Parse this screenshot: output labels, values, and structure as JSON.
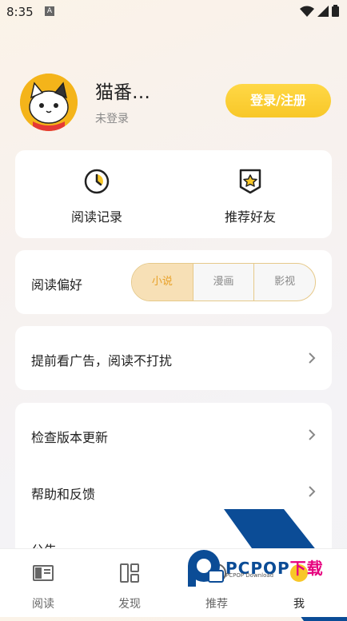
{
  "status_bar": {
    "time": "8:35",
    "notif_icon": "A"
  },
  "profile": {
    "username": "猫番…",
    "login_status": "未登录",
    "login_button": "登录/注册"
  },
  "quick_actions": [
    {
      "label": "阅读记录",
      "icon": "clock-icon"
    },
    {
      "label": "推荐好友",
      "icon": "star-badge-icon"
    }
  ],
  "reading_preference": {
    "label": "阅读偏好",
    "options": [
      "小说",
      "漫画",
      "影视"
    ],
    "selected": "小说"
  },
  "ad_row": {
    "label": "提前看广告，阅读不打扰"
  },
  "settings": [
    {
      "label": "检查版本更新"
    },
    {
      "label": "帮助和反馈"
    },
    {
      "label": "公告"
    }
  ],
  "tabs": [
    {
      "label": "阅读",
      "icon": "book-icon"
    },
    {
      "label": "发现",
      "icon": "grid-icon"
    },
    {
      "label": "推荐",
      "icon": "recommend-icon"
    },
    {
      "label": "我",
      "icon": "profile-icon"
    }
  ],
  "watermark": {
    "brand": "PCPOP",
    "brand_cn": "下载",
    "sub": "PCPOP Download"
  },
  "colors": {
    "accent": "#f8c728",
    "selected_text": "#e8a128",
    "watermark_blue": "#0b4c96"
  }
}
